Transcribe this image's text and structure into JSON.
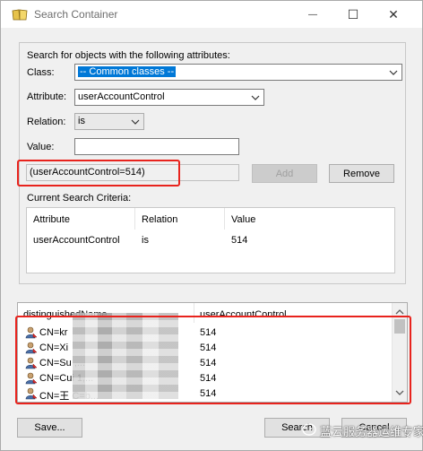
{
  "window": {
    "title": "Search Container",
    "minimize_glyph": "—",
    "maximize_glyph": "☐",
    "close_glyph": "✕"
  },
  "form": {
    "heading": "Search for objects with the following attributes:",
    "class_label": "Class:",
    "class_value": "-- Common classes --",
    "attribute_label": "Attribute:",
    "attribute_value": "userAccountControl",
    "relation_label": "Relation:",
    "relation_value": "is",
    "value_label": "Value:",
    "value_value": "",
    "preview": "(userAccountControl=514)",
    "add_label": "Add",
    "remove_label": "Remove"
  },
  "criteria": {
    "heading": "Current Search Criteria:",
    "columns": [
      "Attribute",
      "Relation",
      "Value"
    ],
    "rows": [
      {
        "attribute": "userAccountControl",
        "relation": "is",
        "value": "514"
      }
    ]
  },
  "results": {
    "columns": [
      "distinguishedName",
      "userAccountControl"
    ],
    "rows": [
      {
        "dn": "CN=kr",
        "uac": "514"
      },
      {
        "dn": "CN=Xi",
        "uac": "514"
      },
      {
        "dn": "CN=Su                        ,...",
        "uac": "514"
      },
      {
        "dn": "CN=Cui                    1,...",
        "uac": "514"
      },
      {
        "dn": "CN=王                      C=b...",
        "uac": "514"
      }
    ]
  },
  "footer": {
    "save_label": "Save...",
    "search_label": "Search",
    "cancel_label": "Cancel"
  },
  "watermark": {
    "text": "蓝云服务器运维专家"
  },
  "colors": {
    "highlight": "#e8231d",
    "selection": "#0078d7"
  }
}
